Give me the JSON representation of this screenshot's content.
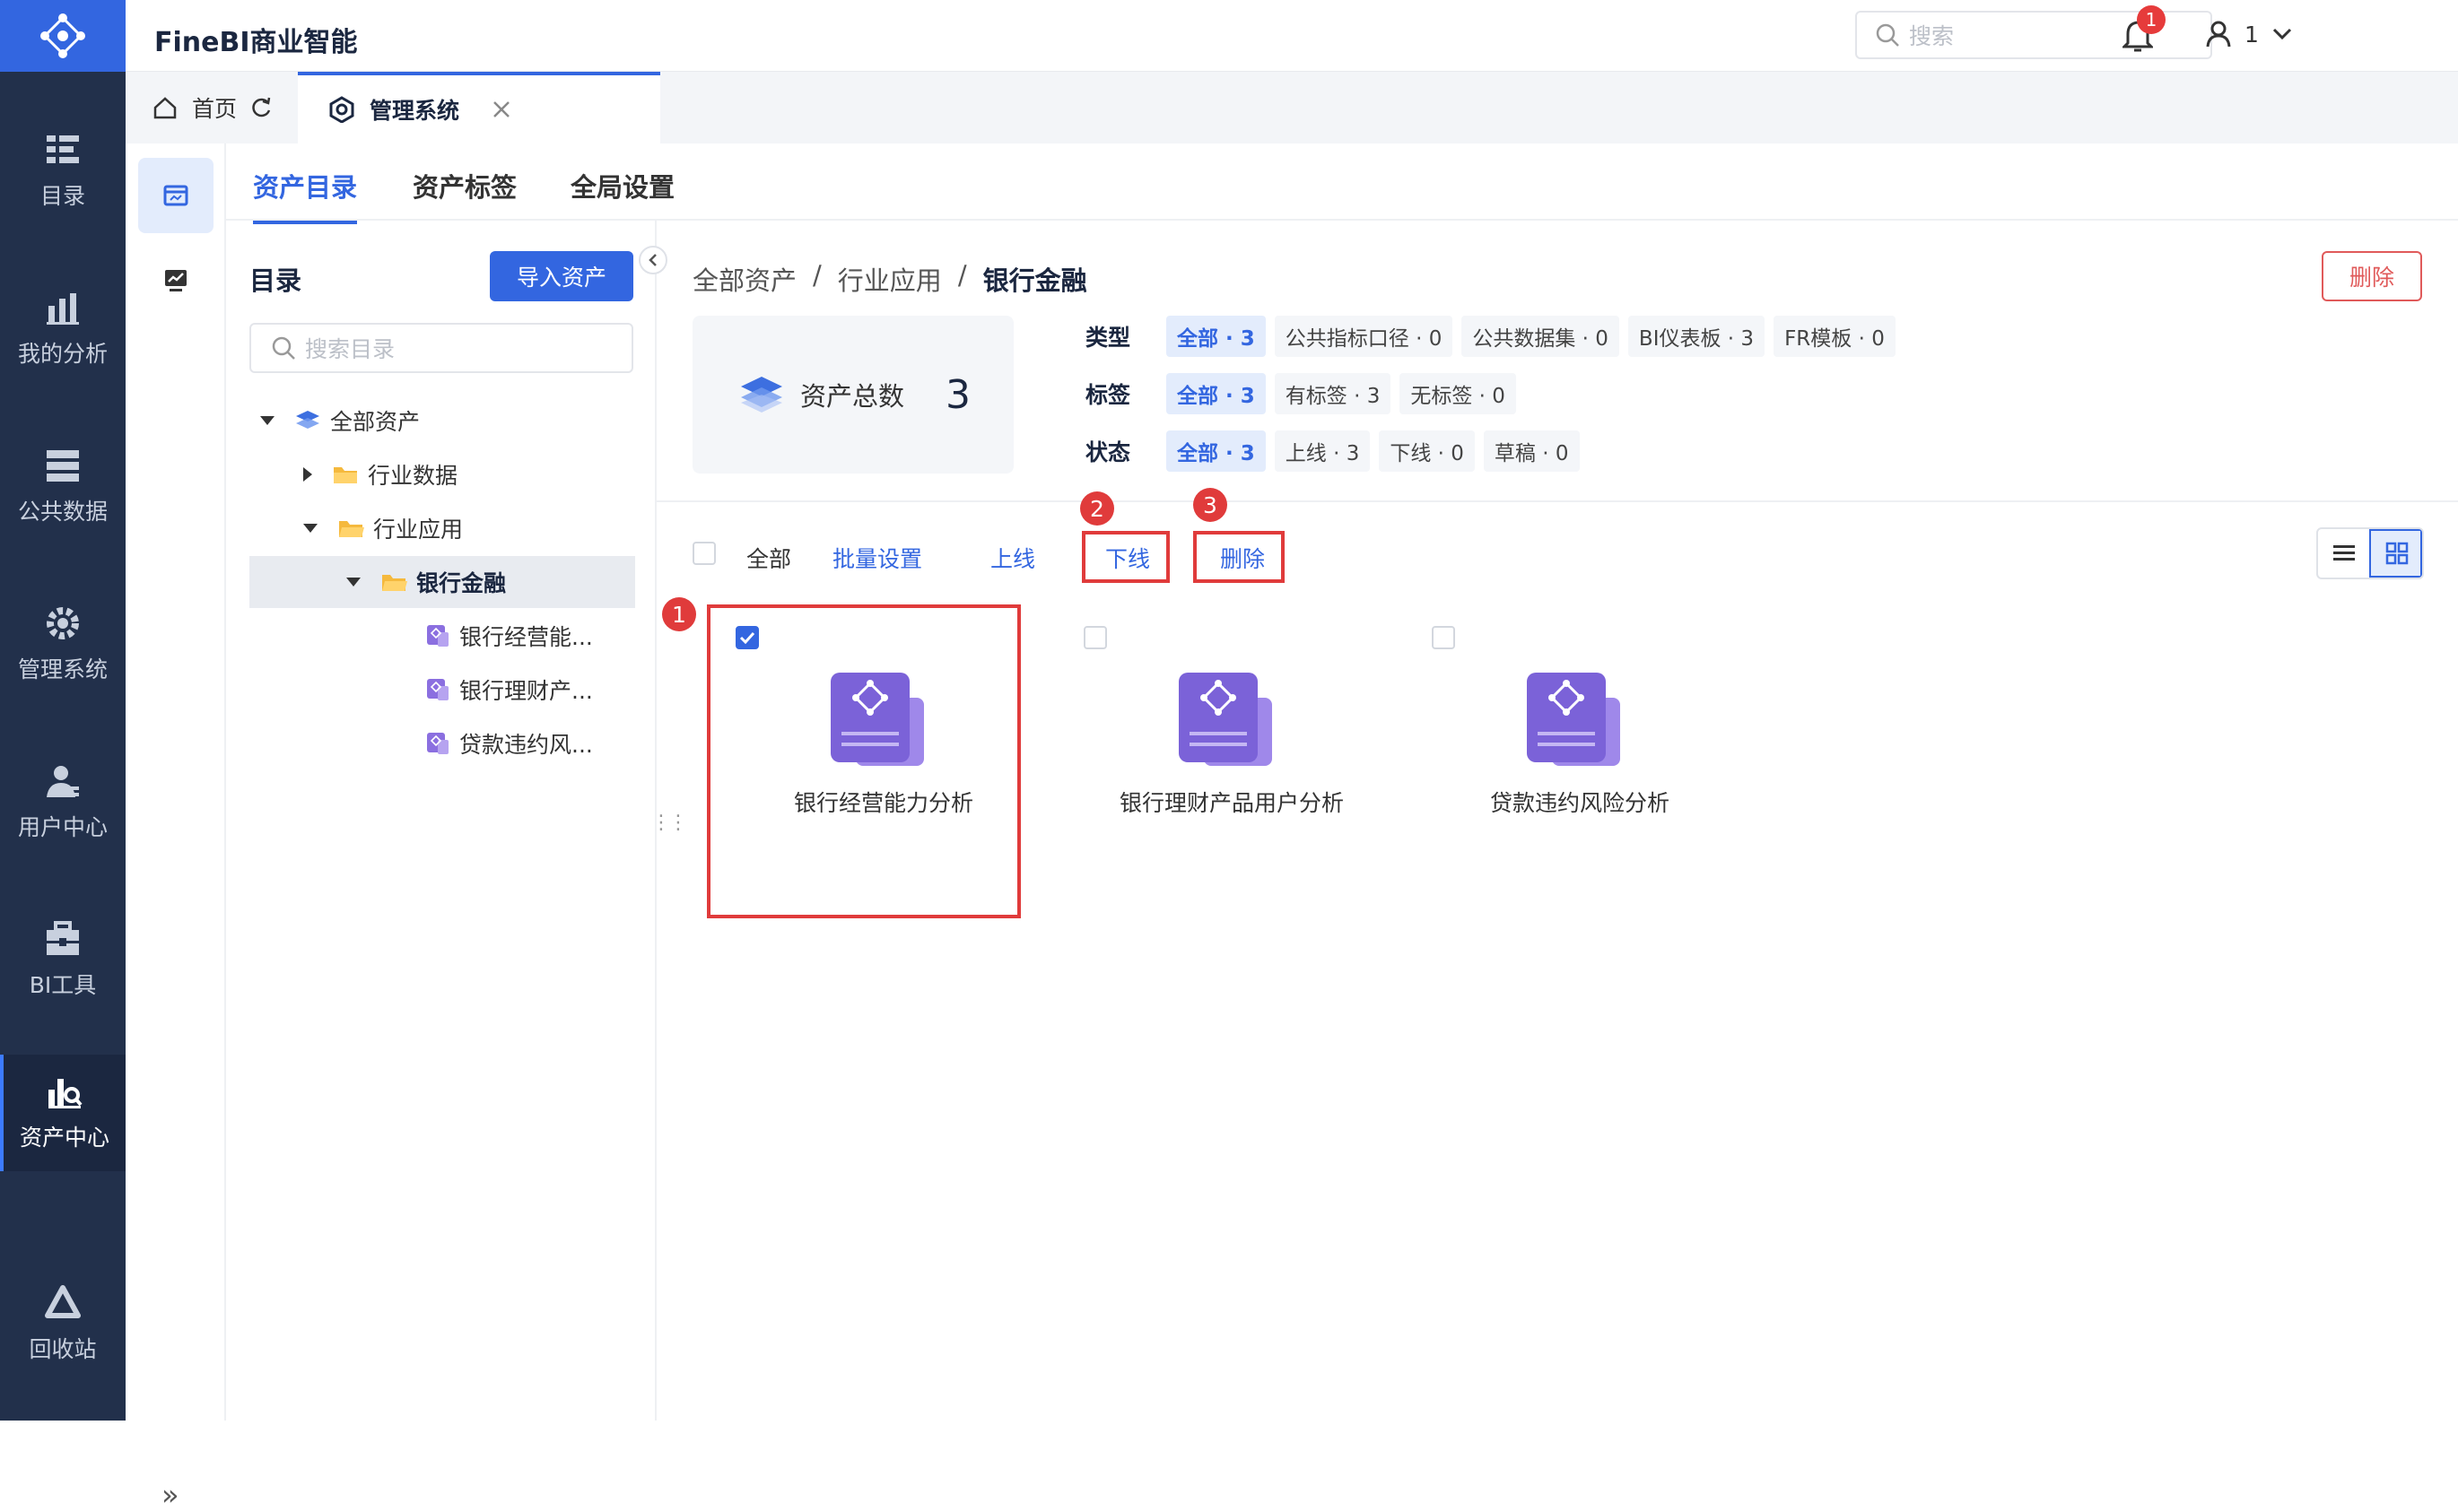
{
  "app": {
    "title": "FineBI商业智能"
  },
  "header": {
    "search_placeholder": "搜索",
    "notification_count": "1",
    "user_name": "1"
  },
  "nav": [
    {
      "label": "目录",
      "icon": "catalog-icon"
    },
    {
      "label": "我的分析",
      "icon": "analysis-icon"
    },
    {
      "label": "公共数据",
      "icon": "database-icon"
    },
    {
      "label": "管理系统",
      "icon": "gear-icon"
    },
    {
      "label": "用户中心",
      "icon": "user-icon"
    },
    {
      "label": "BI工具",
      "icon": "toolbox-icon"
    },
    {
      "label": "资产中心",
      "icon": "asset-icon"
    },
    {
      "label": "回收站",
      "icon": "recycle-icon"
    }
  ],
  "tabs": {
    "home": "首页",
    "admin": "管理系统"
  },
  "main_tabs": [
    "资产目录",
    "资产标签",
    "全局设置"
  ],
  "tree": {
    "title": "目录",
    "import_button": "导入资产",
    "search_placeholder": "搜索目录",
    "items": [
      "全部资产",
      "行业数据",
      "行业应用",
      "银行金融",
      "银行经营能...",
      "银行理财产...",
      "贷款违约风..."
    ]
  },
  "breadcrumb": [
    "全部资产",
    "/",
    "行业应用",
    "/",
    "银行金融"
  ],
  "delete_button": "删除",
  "summary": {
    "label": "资产总数",
    "value": "3"
  },
  "filters": {
    "type": {
      "label": "类型",
      "chips": [
        "全部 · 3",
        "公共指标口径 · 0",
        "公共数据集 · 0",
        "BI仪表板 · 3",
        "FR模板 · 0"
      ]
    },
    "tag": {
      "label": "标签",
      "chips": [
        "全部 · 3",
        "有标签 · 3",
        "无标签 · 0"
      ]
    },
    "status": {
      "label": "状态",
      "chips": [
        "全部 · 3",
        "上线 · 3",
        "下线 · 0",
        "草稿 · 0"
      ]
    }
  },
  "actions": {
    "select_all": "全部",
    "batch": "批量设置",
    "online": "上线",
    "offline": "下线",
    "delete": "删除"
  },
  "markers": [
    "1",
    "2",
    "3"
  ],
  "cards": [
    {
      "title": "银行经营能力分析",
      "checked": true
    },
    {
      "title": "银行理财产品用户分析",
      "checked": false
    },
    {
      "title": "贷款违约风险分析",
      "checked": false
    }
  ],
  "colors": {
    "accent": "#3366e0",
    "nav_bg": "#22304b",
    "highlight": "#e03b3b"
  }
}
